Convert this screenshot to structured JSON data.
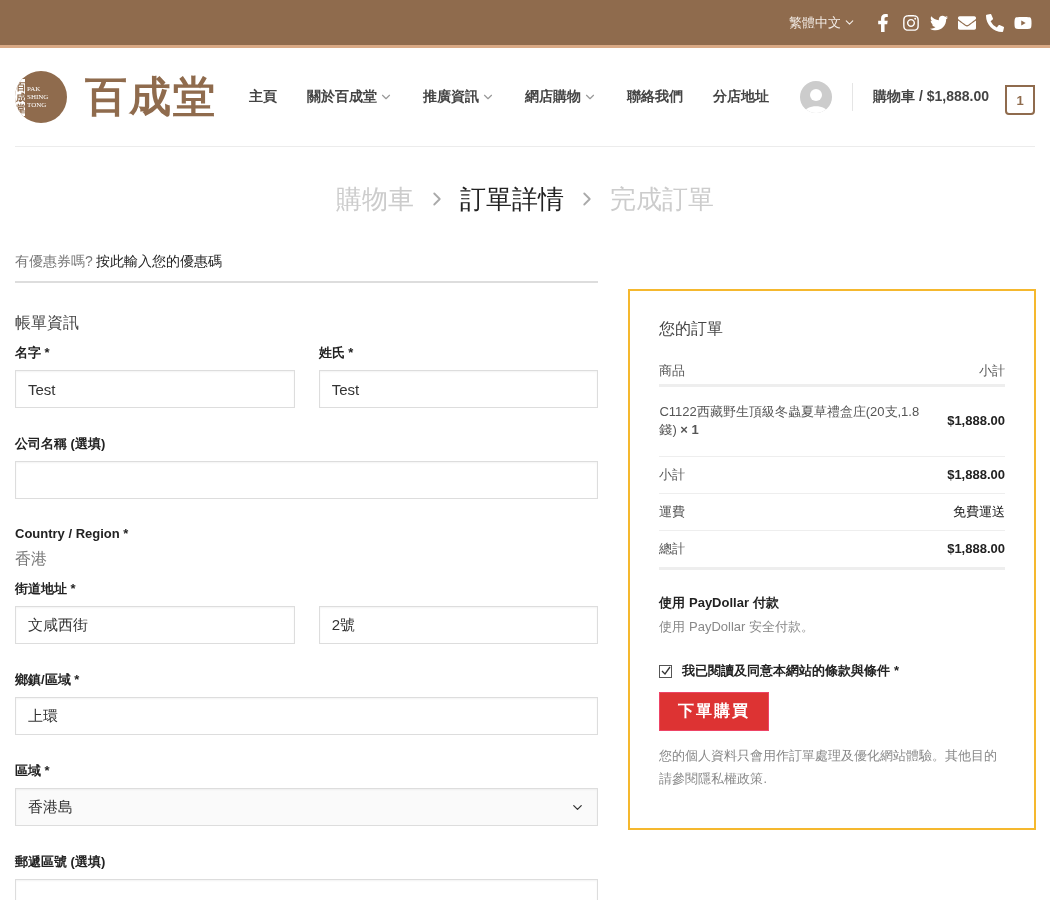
{
  "topbar": {
    "language": "繁體中文"
  },
  "header": {
    "logo": {
      "vertical": "百成堂",
      "latin": [
        "PAK",
        "SHING",
        "TONG"
      ],
      "brand": "百成堂"
    },
    "nav": [
      {
        "label": "主頁",
        "dropdown": false
      },
      {
        "label": "關於百成堂",
        "dropdown": true
      },
      {
        "label": "推廣資訊",
        "dropdown": true
      },
      {
        "label": "網店購物",
        "dropdown": true
      },
      {
        "label": "聯絡我們",
        "dropdown": false
      },
      {
        "label": "分店地址",
        "dropdown": false
      }
    ],
    "cart": {
      "label": "購物車 / $1,888.00",
      "count": "1"
    }
  },
  "steps": [
    {
      "label": "購物車",
      "selected": false
    },
    {
      "label": "訂單詳情",
      "selected": true
    },
    {
      "label": "完成訂單",
      "selected": false
    }
  ],
  "coupon": {
    "question": "有優惠券嗎?",
    "link": "按此輸入您的優惠碼"
  },
  "billing": {
    "title": "帳單資訊",
    "fields": [
      {
        "kind": "pair",
        "labels": [
          "名字 *",
          "姓氏 *"
        ],
        "values": [
          "Test",
          "Test"
        ]
      },
      {
        "kind": "text",
        "label": "公司名稱 (選填)"
      },
      {
        "kind": "static",
        "label": "Country / Region *",
        "value": "香港"
      },
      {
        "kind": "split",
        "label": "街道地址 *",
        "values": [
          "文咸西街",
          "2號"
        ]
      },
      {
        "kind": "text",
        "label": "鄉鎮/區域 *",
        "value": "上環"
      },
      {
        "kind": "select",
        "label": "區域 *",
        "value": "香港島"
      },
      {
        "kind": "text",
        "label": "郵遞區號 (選填)"
      }
    ]
  },
  "order": {
    "title": "您的訂單",
    "columns": [
      "商品",
      "小計"
    ],
    "items": [
      {
        "name": "C1122西藏野生頂級冬蟲夏草禮盒庄(20支,1.8錢)",
        "qty": "× 1",
        "total": "$1,888.00"
      }
    ],
    "rows": [
      {
        "label": "小計",
        "value": "$1,888.00",
        "bold": true
      },
      {
        "label": "運費",
        "value": "免費運送",
        "bold": false
      },
      {
        "label": "總計",
        "value": "$1,888.00",
        "bold": true
      }
    ],
    "payment": {
      "title": "使用 PayDollar 付款",
      "description": "使用 PayDollar 安全付款。"
    },
    "terms": {
      "label": "我已閱讀及同意本網站的條款與條件 *",
      "checked": true
    },
    "button": "下單購買",
    "privacy": "您的個人資料只會用作訂單處理及優化網站體驗。其他目的請參閱隱私權政策."
  }
}
